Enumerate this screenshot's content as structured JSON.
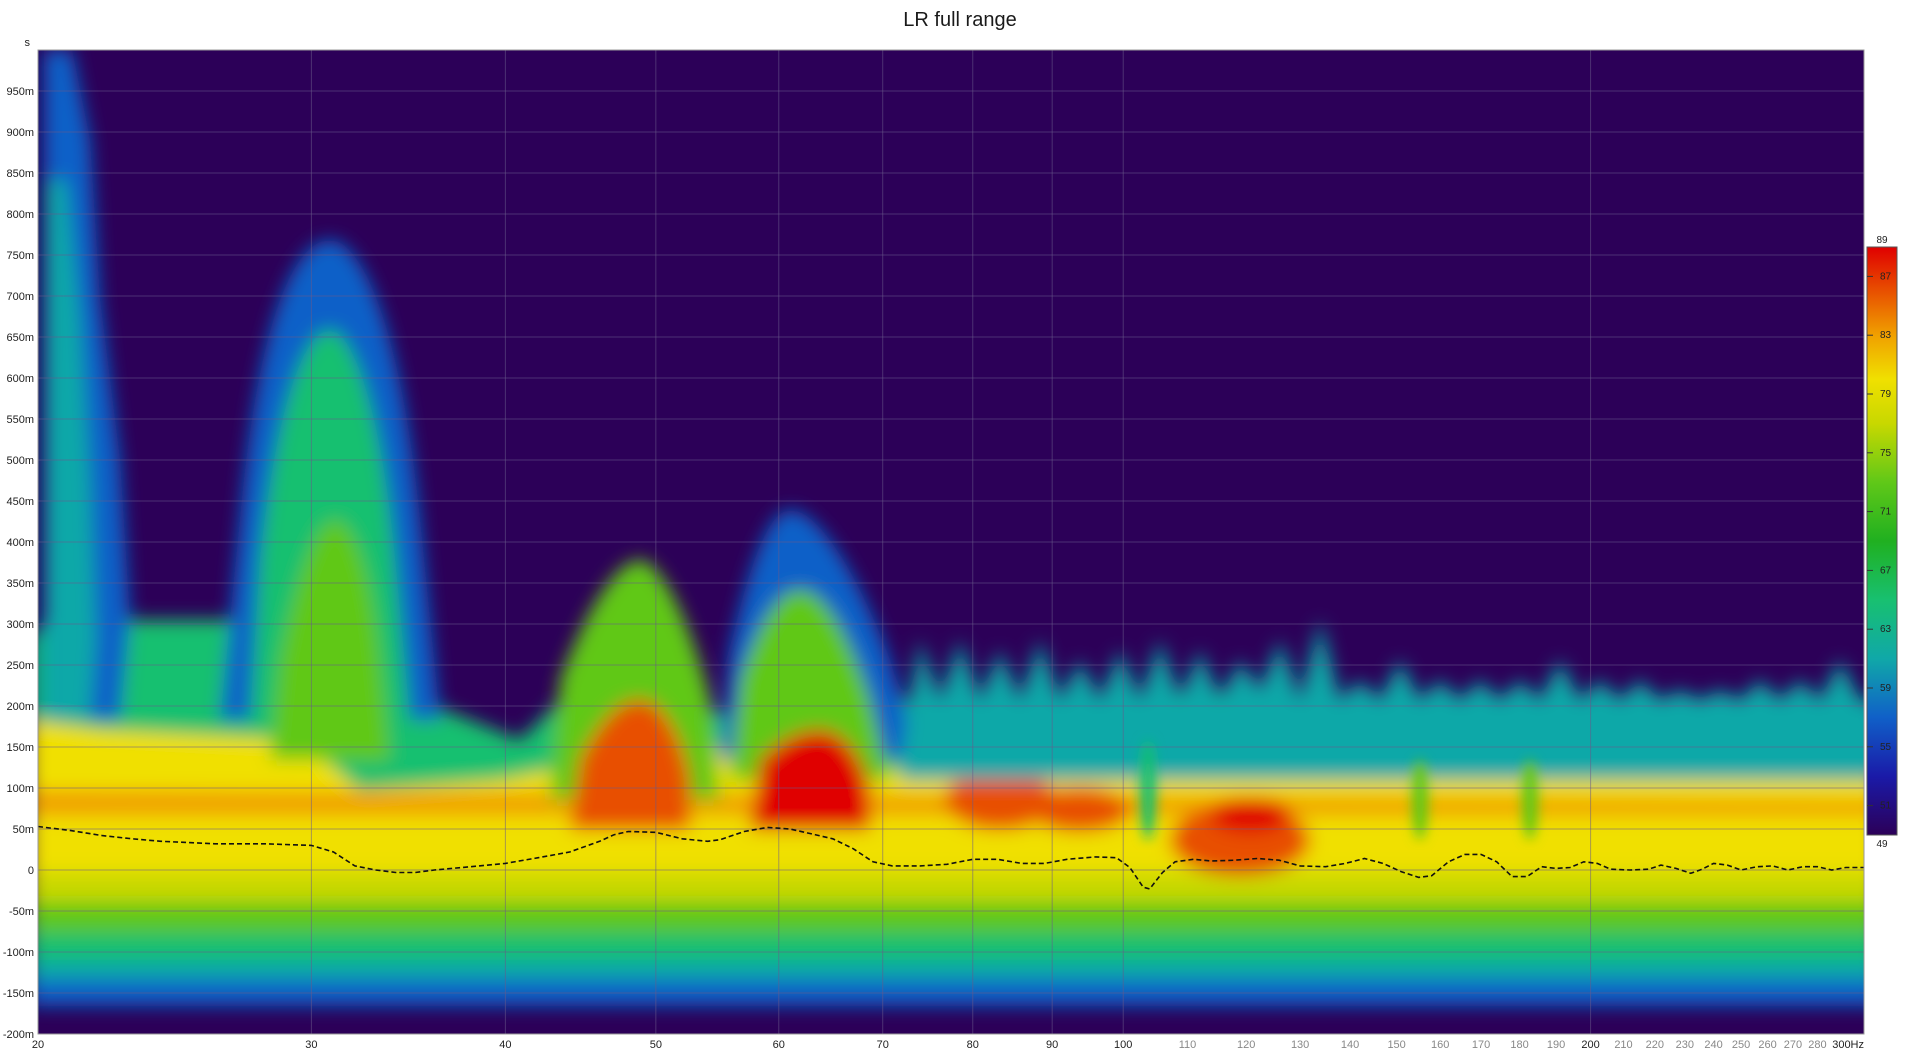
{
  "chart_data": {
    "type": "heatmap",
    "title": "LR full range",
    "ylabel_unit": "s",
    "xlabel_unit": "Hz",
    "x_scale": "log",
    "xlim": [
      20,
      300
    ],
    "ylim": [
      -0.2,
      1.0
    ],
    "grid": true,
    "background_color": "#2c0058",
    "x_ticks_major": [
      {
        "value": 20,
        "label": "20"
      },
      {
        "value": 30,
        "label": "30"
      },
      {
        "value": 40,
        "label": "40"
      },
      {
        "value": 50,
        "label": "50"
      },
      {
        "value": 60,
        "label": "60"
      },
      {
        "value": 70,
        "label": "70"
      },
      {
        "value": 80,
        "label": "80"
      },
      {
        "value": 90,
        "label": "90"
      },
      {
        "value": 100,
        "label": "100"
      },
      {
        "value": 200,
        "label": "200"
      },
      {
        "value": 300,
        "label": "300Hz"
      }
    ],
    "x_ticks_minor": [
      {
        "value": 110,
        "label": "110"
      },
      {
        "value": 120,
        "label": "120"
      },
      {
        "value": 130,
        "label": "130"
      },
      {
        "value": 140,
        "label": "140"
      },
      {
        "value": 150,
        "label": "150"
      },
      {
        "value": 160,
        "label": "160"
      },
      {
        "value": 170,
        "label": "170"
      },
      {
        "value": 180,
        "label": "180"
      },
      {
        "value": 190,
        "label": "190"
      },
      {
        "value": 210,
        "label": "210"
      },
      {
        "value": 220,
        "label": "220"
      },
      {
        "value": 230,
        "label": "230"
      },
      {
        "value": 240,
        "label": "240"
      },
      {
        "value": 250,
        "label": "250"
      },
      {
        "value": 260,
        "label": "260"
      },
      {
        "value": 270,
        "label": "270"
      },
      {
        "value": 280,
        "label": "280"
      }
    ],
    "y_ticks": [
      {
        "value": 0.95,
        "label": "950m"
      },
      {
        "value": 0.9,
        "label": "900m"
      },
      {
        "value": 0.85,
        "label": "850m"
      },
      {
        "value": 0.8,
        "label": "800m"
      },
      {
        "value": 0.75,
        "label": "750m"
      },
      {
        "value": 0.7,
        "label": "700m"
      },
      {
        "value": 0.65,
        "label": "650m"
      },
      {
        "value": 0.6,
        "label": "600m"
      },
      {
        "value": 0.55,
        "label": "550m"
      },
      {
        "value": 0.5,
        "label": "500m"
      },
      {
        "value": 0.45,
        "label": "450m"
      },
      {
        "value": 0.4,
        "label": "400m"
      },
      {
        "value": 0.35,
        "label": "350m"
      },
      {
        "value": 0.3,
        "label": "300m"
      },
      {
        "value": 0.25,
        "label": "250m"
      },
      {
        "value": 0.2,
        "label": "200m"
      },
      {
        "value": 0.15,
        "label": "150m"
      },
      {
        "value": 0.1,
        "label": "100m"
      },
      {
        "value": 0.05,
        "label": "50m"
      },
      {
        "value": 0.0,
        "label": "0"
      },
      {
        "value": -0.05,
        "label": "-50m"
      },
      {
        "value": -0.1,
        "label": "-100m"
      },
      {
        "value": -0.15,
        "label": "-150m"
      },
      {
        "value": -0.2,
        "label": "-200m"
      }
    ],
    "colorbar": {
      "min": 49,
      "max": 89,
      "ticks": [
        89,
        87,
        83,
        79,
        75,
        71,
        67,
        63,
        59,
        55,
        51,
        49
      ],
      "stops": [
        {
          "value": 49,
          "color": "#2c0058"
        },
        {
          "value": 53,
          "color": "#1a1aa8"
        },
        {
          "value": 57,
          "color": "#1060c8"
        },
        {
          "value": 61,
          "color": "#10a8a8"
        },
        {
          "value": 65,
          "color": "#18c070"
        },
        {
          "value": 69,
          "color": "#20b020"
        },
        {
          "value": 73,
          "color": "#60c818"
        },
        {
          "value": 77,
          "color": "#c8d800"
        },
        {
          "value": 80,
          "color": "#f0e000"
        },
        {
          "value": 83,
          "color": "#f0a000"
        },
        {
          "value": 86,
          "color": "#e85000"
        },
        {
          "value": 89,
          "color": "#e00000"
        }
      ]
    },
    "peak_time_line": {
      "style": "dashed",
      "color": "#111111",
      "points": [
        [
          20,
          0.053
        ],
        [
          21,
          0.048
        ],
        [
          22,
          0.042
        ],
        [
          23,
          0.038
        ],
        [
          24,
          0.035
        ],
        [
          26,
          0.032
        ],
        [
          28,
          0.032
        ],
        [
          30,
          0.03
        ],
        [
          31,
          0.022
        ],
        [
          32,
          0.005
        ],
        [
          33,
          0.0
        ],
        [
          34,
          -0.003
        ],
        [
          35,
          -0.003
        ],
        [
          36,
          0.0
        ],
        [
          38,
          0.004
        ],
        [
          40,
          0.008
        ],
        [
          42,
          0.015
        ],
        [
          44,
          0.022
        ],
        [
          46,
          0.035
        ],
        [
          47,
          0.043
        ],
        [
          48,
          0.047
        ],
        [
          50,
          0.046
        ],
        [
          52,
          0.038
        ],
        [
          54,
          0.035
        ],
        [
          55,
          0.037
        ],
        [
          57,
          0.047
        ],
        [
          59,
          0.052
        ],
        [
          61,
          0.05
        ],
        [
          63,
          0.044
        ],
        [
          65,
          0.038
        ],
        [
          67,
          0.026
        ],
        [
          69,
          0.01
        ],
        [
          71,
          0.005
        ],
        [
          74,
          0.005
        ],
        [
          77,
          0.007
        ],
        [
          80,
          0.013
        ],
        [
          83,
          0.013
        ],
        [
          86,
          0.008
        ],
        [
          89,
          0.008
        ],
        [
          92,
          0.013
        ],
        [
          96,
          0.016
        ],
        [
          99,
          0.015
        ],
        [
          101,
          0.003
        ],
        [
          103,
          -0.021
        ],
        [
          104,
          -0.023
        ],
        [
          106,
          -0.003
        ],
        [
          108,
          0.01
        ],
        [
          111,
          0.013
        ],
        [
          114,
          0.011
        ],
        [
          118,
          0.012
        ],
        [
          122,
          0.014
        ],
        [
          126,
          0.012
        ],
        [
          130,
          0.005
        ],
        [
          135,
          0.004
        ],
        [
          139,
          0.008
        ],
        [
          143,
          0.014
        ],
        [
          147,
          0.008
        ],
        [
          151,
          -0.002
        ],
        [
          155,
          -0.009
        ],
        [
          158,
          -0.007
        ],
        [
          162,
          0.01
        ],
        [
          166,
          0.019
        ],
        [
          170,
          0.019
        ],
        [
          174,
          0.01
        ],
        [
          178,
          -0.008
        ],
        [
          182,
          -0.008
        ],
        [
          186,
          0.004
        ],
        [
          190,
          0.002
        ],
        [
          194,
          0.003
        ],
        [
          198,
          0.01
        ],
        [
          202,
          0.008
        ],
        [
          206,
          0.001
        ],
        [
          212,
          0.0
        ],
        [
          218,
          0.001
        ],
        [
          222,
          0.006
        ],
        [
          227,
          0.002
        ],
        [
          232,
          -0.004
        ],
        [
          236,
          0.001
        ],
        [
          240,
          0.008
        ],
        [
          245,
          0.006
        ],
        [
          250,
          0.0
        ],
        [
          256,
          0.004
        ],
        [
          262,
          0.005
        ],
        [
          268,
          0.0
        ],
        [
          274,
          0.004
        ],
        [
          280,
          0.004
        ],
        [
          286,
          0.0
        ],
        [
          292,
          0.003
        ],
        [
          300,
          0.003
        ]
      ]
    }
  }
}
